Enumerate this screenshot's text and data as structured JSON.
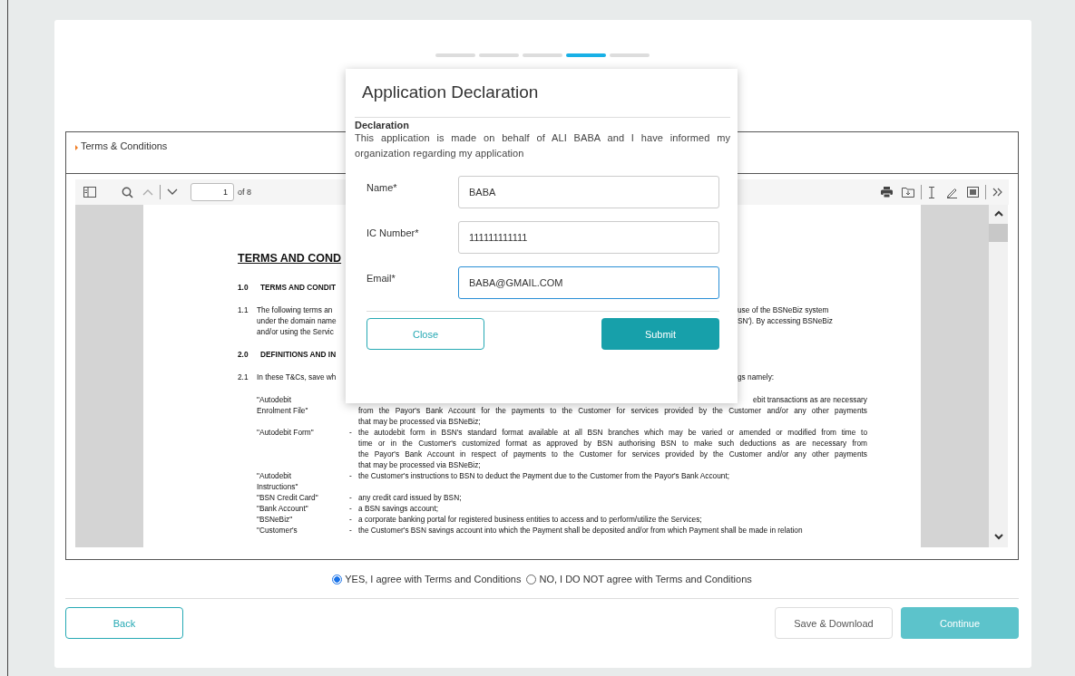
{
  "stepper": [
    {
      "selected": false
    },
    {
      "selected": false
    },
    {
      "selected": false
    },
    {
      "selected": true
    },
    {
      "selected": false
    }
  ],
  "terms_panel": {
    "title": "Terms & Conditions",
    "viewer": {
      "page_number": "1",
      "page_count": "of 8",
      "document": [
        {
          "kind": "heading",
          "text": "TERMS AND COND"
        },
        {
          "kind": "section",
          "number": "1.0",
          "left": [
            "TERMS AND CONDIT"
          ]
        },
        {
          "kind": "clause",
          "number": "1.1",
          "left": [
            "The following terms an",
            "under the domain name",
            "and/or using the Servic"
          ],
          "right": [
            "use of the BSNeBiz system",
            "SN'). By accessing BSNeBiz"
          ]
        },
        {
          "kind": "section",
          "number": "2.0",
          "left": [
            "DEFINITIONS AND IN"
          ]
        },
        {
          "kind": "clause",
          "number": "2.1",
          "left": [
            "In these T&Cs, save wh"
          ],
          "right": [
            "gs namely:"
          ]
        }
      ],
      "definitions": [
        {
          "kind": "covered",
          "term": [
            "\"Autodebit",
            "Enrolment File\""
          ],
          "lines": [
            "ebit transactions as are necessary",
            "from the Payor's Bank Account for the payments to the Customer for services provided by the Customer and/or any other payments",
            "that may be processed via BSNeBiz;"
          ]
        },
        {
          "kind": "full",
          "dash": "-",
          "term": [
            "\"Autodebit Form\""
          ],
          "lines": [
            "the autodebit form in BSN's standard format available at all BSN branches which may be varied or amended or modified from time to",
            "time or in the Customer's customized format as approved by BSN authorising BSN to make such deductions as are necessary from",
            "the Payor's Bank Account in respect of payments to the Customer for services provided by the Customer and/or any other payments",
            "that may be processed via BSNeBiz;"
          ]
        },
        {
          "kind": "full",
          "dash": "-",
          "term": [
            "\"Autodebit",
            "Instructions\""
          ],
          "lines": [
            "the Customer's instructions to BSN to deduct the Payment due to the Customer from the Payor's Bank Account;"
          ]
        },
        {
          "kind": "full",
          "dash": "-",
          "term": [
            "\"BSN Credit Card\""
          ],
          "lines": [
            "any credit card issued by BSN;"
          ]
        },
        {
          "kind": "full",
          "dash": "-",
          "term": [
            "\"Bank Account\""
          ],
          "lines": [
            "a BSN savings account;"
          ]
        },
        {
          "kind": "full",
          "dash": "-",
          "term": [
            "\"BSNeBiz\""
          ],
          "lines": [
            "a corporate banking portal for registered business entities to access and to perform/utilize the Services;"
          ]
        },
        {
          "kind": "full",
          "dash": "-",
          "term": [
            "\"Customer's"
          ],
          "lines": [
            "the Customer's BSN savings account into which the Payment shall be deposited and/or from which Payment shall be made in relation"
          ]
        }
      ]
    }
  },
  "agreement": [
    {
      "label": "YES, I agree with Terms and Conditions",
      "selected": true
    },
    {
      "label": "NO, I DO NOT agree with Terms and Conditions",
      "selected": false
    }
  ],
  "footer_buttons": [
    {
      "label": "Back",
      "kind": "outline"
    },
    {
      "label": "Save & Download",
      "kind": "plain"
    },
    {
      "label": "Continue",
      "kind": "primary"
    }
  ],
  "dialog": {
    "title": "Application Declaration",
    "subtitle": "Declaration",
    "text": "This application is made on behalf of ALI BABA and I have informed my organization regarding my application",
    "fields": [
      {
        "label": "Name*",
        "value": "BABA",
        "focused": false
      },
      {
        "label": "IC Number*",
        "value": "111111111111",
        "focused": false
      },
      {
        "label": "Email*",
        "value": "BABA@GMAIL.COM",
        "focused": true
      }
    ],
    "buttons": [
      {
        "label": "Close",
        "kind": "outline"
      },
      {
        "label": "Submit",
        "kind": "primary"
      }
    ]
  }
}
